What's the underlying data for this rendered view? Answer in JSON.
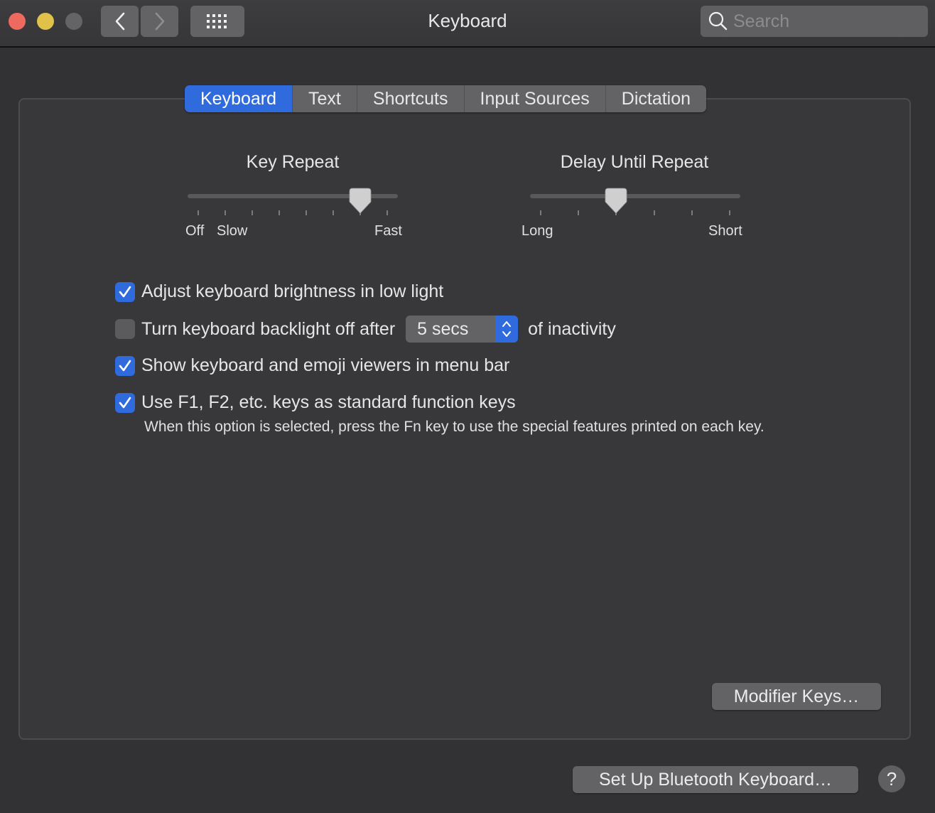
{
  "window": {
    "title": "Keyboard",
    "search_placeholder": "Search"
  },
  "toolbar": {
    "back": "back",
    "forward": "forward",
    "show_all": "show-all-grid"
  },
  "tabs": [
    {
      "label": "Keyboard",
      "active": true
    },
    {
      "label": "Text",
      "active": false
    },
    {
      "label": "Shortcuts",
      "active": false
    },
    {
      "label": "Input Sources",
      "active": false
    },
    {
      "label": "Dictation",
      "active": false
    }
  ],
  "key_repeat": {
    "title": "Key Repeat",
    "labels": {
      "off": "Off",
      "slow": "Slow",
      "fast": "Fast"
    },
    "tick_count": 8,
    "value_index": 6
  },
  "delay_until_repeat": {
    "title": "Delay Until Repeat",
    "labels": {
      "long": "Long",
      "short": "Short"
    },
    "tick_count": 6,
    "value_index": 2
  },
  "options": [
    {
      "label": "Adjust keyboard brightness in low light",
      "checked": true
    },
    {
      "label": "Turn keyboard backlight off after",
      "checked": false,
      "popup_value": "5 secs",
      "suffix": "of inactivity"
    },
    {
      "label": "Show keyboard and emoji viewers in menu bar",
      "checked": true
    },
    {
      "label": "Use F1, F2, etc. keys as standard function keys",
      "checked": true
    }
  ],
  "fn_hint": "When this option is selected, press the Fn key to use the special features printed on each key.",
  "buttons": {
    "modifier_keys": "Modifier Keys…",
    "bluetooth": "Set Up Bluetooth Keyboard…",
    "help": "?"
  },
  "colors": {
    "accent": "#2f6bdc",
    "close": "#ee6a5e",
    "minimize": "#e0c24a",
    "zoom_disabled": "#646466"
  }
}
